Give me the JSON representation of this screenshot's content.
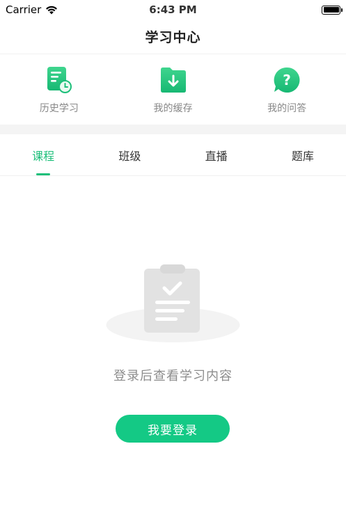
{
  "status_bar": {
    "carrier": "Carrier",
    "time": "6:43 PM",
    "icons": [
      "wifi-icon",
      "battery-icon"
    ]
  },
  "nav": {
    "title": "学习中心"
  },
  "quick_entries": [
    {
      "label": "历史学习",
      "icon": "history-document-icon"
    },
    {
      "label": "我的缓存",
      "icon": "download-folder-icon"
    },
    {
      "label": "我的问答",
      "icon": "question-bubble-icon"
    }
  ],
  "tabs": [
    {
      "label": "课程",
      "active": true
    },
    {
      "label": "班级",
      "active": false
    },
    {
      "label": "直播",
      "active": false
    },
    {
      "label": "题库",
      "active": false
    }
  ],
  "empty_state": {
    "illustration": "clipboard-check-icon",
    "message": "登录后查看学习内容",
    "button_label": "我要登录"
  },
  "colors": {
    "accent": "#1dbf7a",
    "button": "#14c985",
    "muted_text": "#8c8c8c"
  }
}
